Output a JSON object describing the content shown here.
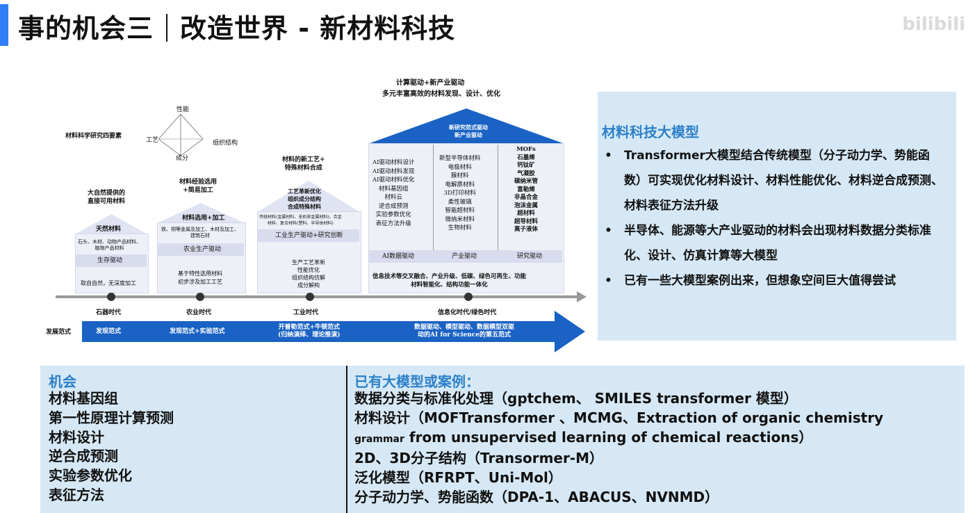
{
  "header": {
    "title_left": "事的机会三",
    "title_right": "改造世界 - 新材料科技",
    "watermark": "bilibili"
  },
  "diagram": {
    "top_caption_line1": "计算驱动+新产业驱动",
    "top_caption_line2": "多元丰富高效的材料发现、设计、优化",
    "four_elements_title": "材料科学研究四要素",
    "pyramid_top": "性能",
    "pyramid_left": "工艺",
    "pyramid_right": "组织结构",
    "pyramid_bottom": "成分",
    "house1_caption": "大自然提供的\n直接可用材料",
    "house1_label": "天然材料",
    "house1_body": "石头、木材、动物产品材料、\n植物产品材料",
    "house1_band": "生存驱动",
    "house1_note": "取自自然，无深度加工",
    "house2_caption": "材料经验选用\n+简易加工",
    "house2_label": "材料选用+加工",
    "house2_body": "铁、铜等金属及加工、木材及加工、\n建筑石材",
    "house2_band": "农业生产驱动",
    "house2_note": "基于特性选用材料\n初步涉及加工工艺",
    "house3_caption": "材料的新工艺+\n特殊材料合成",
    "house3_label": "工艺革新优化\n组织成分结构\n合成特殊材料",
    "house3_body": "传统材料(金属材料、无机非金属材料)、合金\n材料、复合材料(塑料、半导体材料)",
    "house3_band": "工业生产驱动+研究创新",
    "house3_note": "生产工艺革新\n性能优化\n组织结构仿解\n成分解构",
    "house4_roof": "新研究范式驱动\n新产业驱动",
    "house4_col1": "AI驱动材料设计\nAI驱动材料发现\nAI驱动材料优化\n材料基因组\n材料云\n逆合成预测\n实验参数优化\n表征方法升级",
    "house4_col2": "新型半导体材料\n电极材料\n膜材料\n电解质材料\n3D打印材料\n柔性玻璃\n智能超材料\n微纳米材料\n生物材料",
    "house4_col3": "MOFs\n石墨烯\n钙钛矿\n气凝胶\n碳纳米管\n富勒烯\n非晶合金\n泡沫金属\n超材料\n超导材料\n离子液体",
    "house4_band1": "AI数据驱动",
    "house4_band2": "产业驱动",
    "house4_band3": "研究驱动",
    "house4_note": "信息技术等交叉融合、产业升级、低碳、绿色可再生、功能\n材料智能化、结构功能一体化",
    "era1": "石器时代",
    "era2": "农业时代",
    "era3": "工业时代",
    "era4": "信息化时代/绿色时代",
    "paradigm_label": "发展范式",
    "paradigm1": "发现范式",
    "paradigm2": "发现范式+实验范式",
    "paradigm3": "开普勒范式+牛顿范式\n(归纳演绎、理论推演)",
    "paradigm4": "数据驱动、模型驱动、数据模型双驱\n动的AI for Science的第五范式"
  },
  "panel": {
    "title": "材料科技大模型",
    "bullet_char": "•",
    "items": [
      "Transformer大模型结合传统模型（分子动力学、势能函数）可实现优化材料设计、材料性能优化、材料逆合成预测、材料表征方法升级",
      "半导体、能源等大产业驱动的材料会出现材料数据分类标准化、设计、仿真计算等大模型",
      "已有一些大模型案例出来，但想象空间巨大值得尝试"
    ]
  },
  "bottom": {
    "left_header": "机会",
    "left_items": [
      "材料基因组",
      "第一性原理计算预测",
      "材料设计",
      "逆合成预测",
      "实验参数优化",
      "表征方法"
    ],
    "right_header": "已有大模型或案例：",
    "right_items": [
      "数据分类与标准化处理（gptchem、 SMILES transformer 模型）",
      "材料设计（MOFTransformer 、MCMG、Extraction of organic chemistry",
      "from unsupervised learning of chemical reactions）",
      "2D、3D分子结构（Transormer-M）",
      "泛化模型（RFRPT、Uni-Mol）",
      "分子动力学、势能函数（DPA-1、ABACUS、NVNMD）"
    ],
    "right_line3_lead": "grammar"
  }
}
